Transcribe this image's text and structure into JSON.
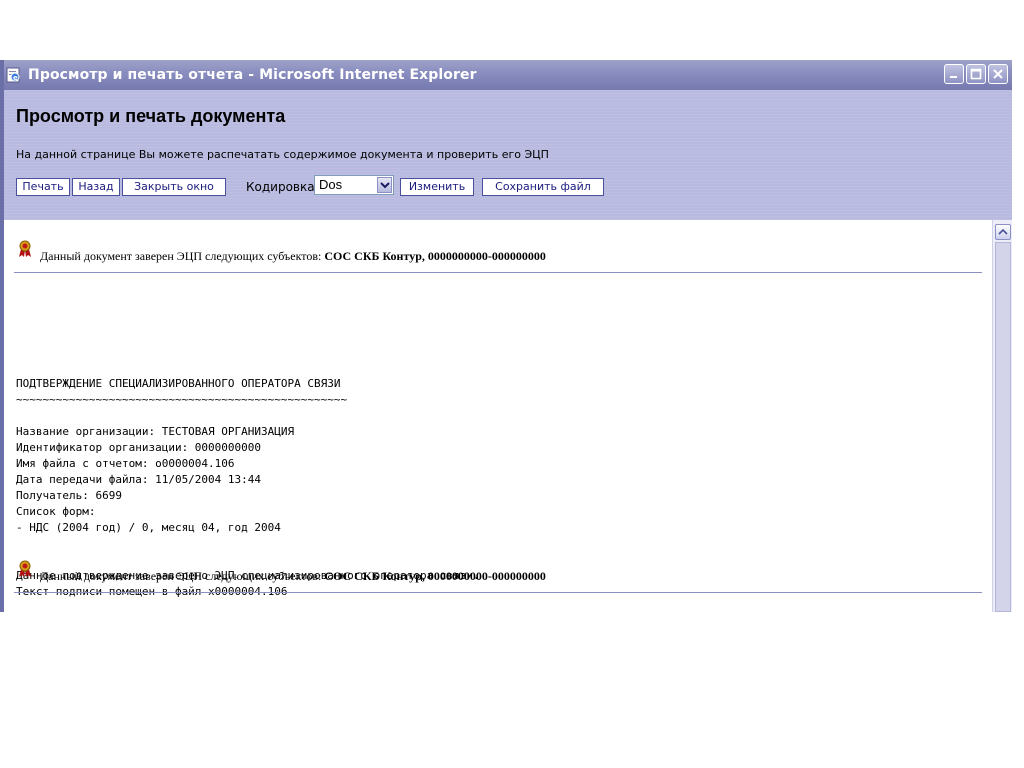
{
  "window": {
    "title": "Просмотр и печать отчета - Microsoft Internet Explorer"
  },
  "header": {
    "heading": "Просмотр и печать документа",
    "description": "На данной странице Вы можете распечатать содержимое документа и проверить его ЭЦП",
    "buttons": {
      "print": "Печать",
      "back": "Назад",
      "close_window": "Закрыть окно",
      "change": "Изменить",
      "save_file": "Сохранить файл"
    },
    "encoding": {
      "label": "Кодировка:",
      "selected": "Dos"
    }
  },
  "signature": {
    "prefix": "Данный документ заверен ЭЦП следующих субъектов: ",
    "subject": "СОС СКБ Контур, 0000000000-000000000"
  },
  "document": {
    "heading": "ПОДТВЕРЖДЕНИЕ СПЕЦИАЛИЗИРОВАННОГО ОПЕРАТОРА СВЯЗИ",
    "underline": "~~~~~~~~~~~~~~~~~~~~~~~~~~~~~~~~~~~~~~~~~~~~~~~~~~",
    "fields": [
      "Название организации: ТЕСТОВАЯ ОРГАНИЗАЦИЯ",
      "Идентификатор организации: 0000000000",
      "Имя файла с отчетом: о0000004.106",
      "Дата передачи файла: 11/05/2004 13:44",
      "Получатель: 6699",
      "Список форм:",
      "- НДС (2004 год) / 0, месяц 04, год 2004"
    ],
    "footer": [
      "Данное подтверждение заверено ЭЦП специализированного оператора связи.",
      "Текст подписи помещен в файл x0000004.106"
    ]
  }
}
